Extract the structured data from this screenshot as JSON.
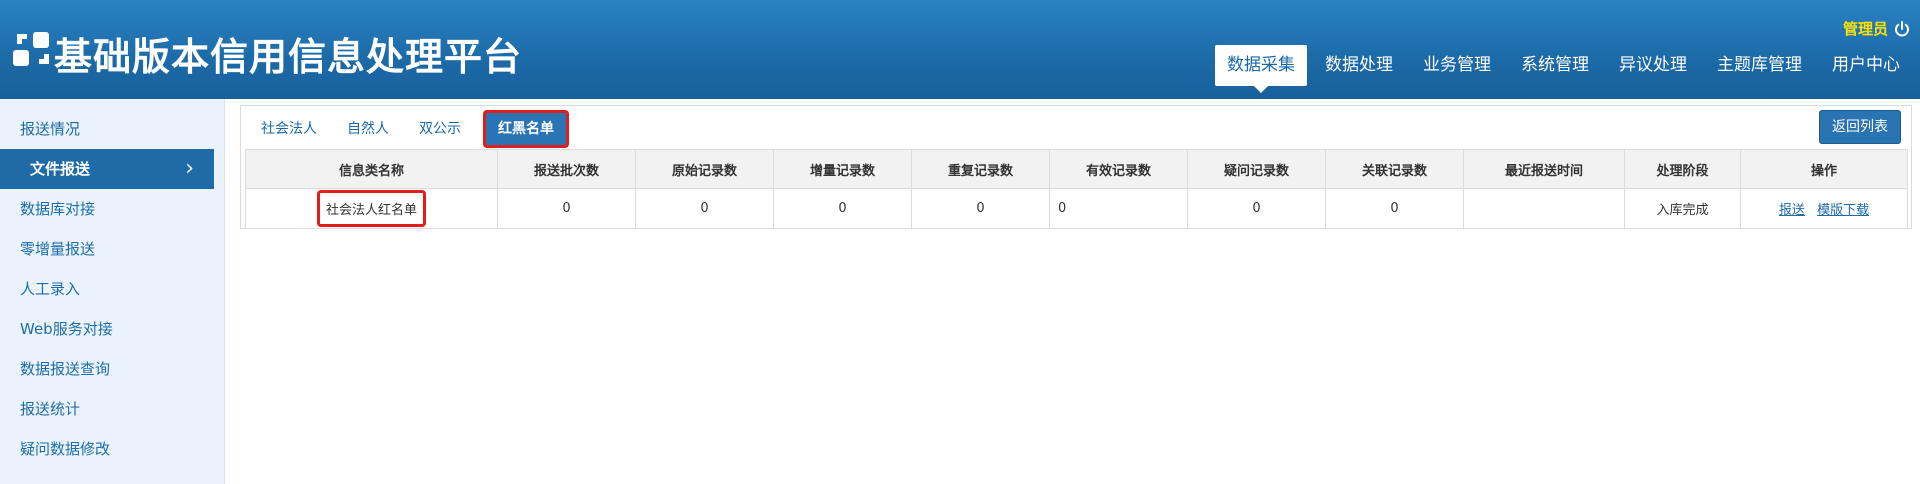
{
  "app": {
    "title": "基础版本信用信息处理平台",
    "user": "管理员"
  },
  "topnav": [
    {
      "label": "数据采集",
      "active": true
    },
    {
      "label": "数据处理",
      "active": false
    },
    {
      "label": "业务管理",
      "active": false
    },
    {
      "label": "系统管理",
      "active": false
    },
    {
      "label": "异议处理",
      "active": false
    },
    {
      "label": "主题库管理",
      "active": false
    },
    {
      "label": "用户中心",
      "active": false
    }
  ],
  "sidebar": [
    {
      "label": "报送情况",
      "active": false
    },
    {
      "label": "文件报送",
      "active": true
    },
    {
      "label": "数据库对接",
      "active": false
    },
    {
      "label": "零增量报送",
      "active": false
    },
    {
      "label": "人工录入",
      "active": false
    },
    {
      "label": "Web服务对接",
      "active": false
    },
    {
      "label": "数据报送查询",
      "active": false
    },
    {
      "label": "报送统计",
      "active": false
    },
    {
      "label": "疑问数据修改",
      "active": false
    }
  ],
  "tabs": [
    {
      "label": "社会法人",
      "active": false
    },
    {
      "label": "自然人",
      "active": false
    },
    {
      "label": "双公示",
      "active": false
    },
    {
      "label": "红黑名单",
      "active": true
    }
  ],
  "back_button": "返回列表",
  "table": {
    "columns": [
      "信息类名称",
      "报送批次数",
      "原始记录数",
      "增量记录数",
      "重复记录数",
      "有效记录数",
      "疑问记录数",
      "关联记录数",
      "最近报送时间",
      "处理阶段",
      "操作"
    ],
    "rows": [
      {
        "name": "社会法人红名单",
        "batches": "0",
        "raw": "0",
        "incremental": "0",
        "duplicate": "0",
        "valid": "0",
        "questionable": "0",
        "related": "0",
        "last_time": "",
        "stage": "入库完成",
        "actions": [
          "报送",
          "模版下载"
        ]
      }
    ]
  },
  "colors": {
    "header": "#1c6aa8",
    "accent": "#2a74b3",
    "highlight_border": "#e31c1c",
    "user_name": "#ffe100"
  }
}
